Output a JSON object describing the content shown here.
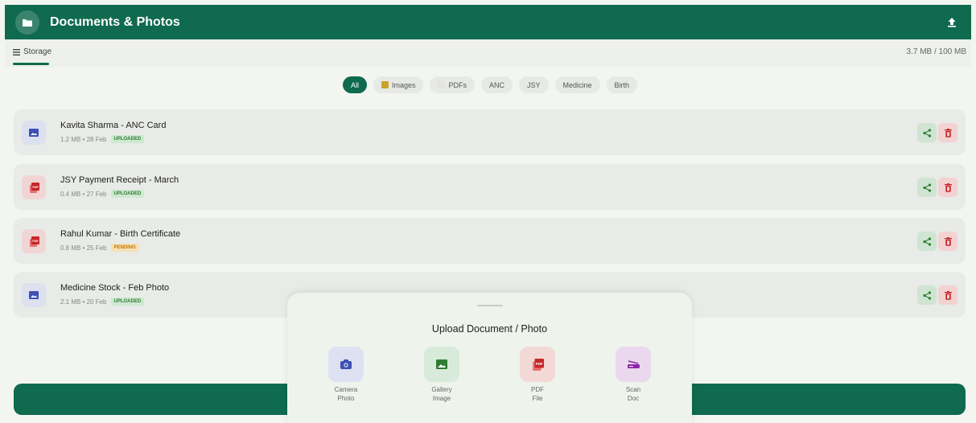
{
  "header": {
    "title": "Documents & Photos",
    "folder_icon": "folder-icon",
    "upload_icon": "upload-icon"
  },
  "storage": {
    "label": "Storage",
    "usage": "3.7 MB / 100 MB"
  },
  "filters": [
    {
      "label": "All",
      "active": true
    },
    {
      "label": "Images",
      "icon": "image-icon"
    },
    {
      "label": "PDFs",
      "icon": "pdf-icon"
    },
    {
      "label": "ANC"
    },
    {
      "label": "JSY"
    },
    {
      "label": "Medicine"
    },
    {
      "label": "Birth"
    }
  ],
  "documents": [
    {
      "name": "Kavita Sharma - ANC Card",
      "meta": "1.2 MB • 28 Feb",
      "status": "UPLOADED",
      "type": "image"
    },
    {
      "name": "JSY Payment Receipt - March",
      "meta": "0.4 MB • 27 Feb",
      "status": "UPLOADED",
      "type": "pdf"
    },
    {
      "name": "Rahul Kumar - Birth Certificate",
      "meta": "0.8 MB • 25 Feb",
      "status": "PENDING",
      "type": "pdf"
    },
    {
      "name": "Medicine Stock - Feb Photo",
      "meta": "2.1 MB • 20 Feb",
      "status": "UPLOADED",
      "type": "image"
    }
  ],
  "sheet": {
    "title": "Upload Document / Photo",
    "options": [
      {
        "line1": "Camera",
        "line2": "Photo",
        "icon": "camera-icon"
      },
      {
        "line1": "Gallery",
        "line2": "Image",
        "icon": "gallery-icon"
      },
      {
        "line1": "PDF",
        "line2": "File",
        "icon": "pdf-icon"
      },
      {
        "line1": "Scan",
        "line2": "Doc",
        "icon": "scanner-icon"
      }
    ]
  },
  "colors": {
    "primary": "#0f6a4e",
    "uploaded": "#2e7d32",
    "pending": "#c77700",
    "pdf": "#c62828",
    "image": "#3f51b5",
    "scan": "#8e24aa"
  }
}
